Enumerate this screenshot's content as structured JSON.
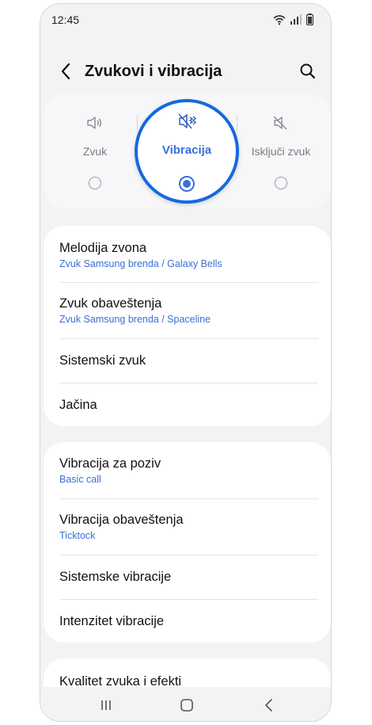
{
  "status_bar": {
    "time": "12:45"
  },
  "header": {
    "title": "Zvukovi i vibracija"
  },
  "sound_modes": [
    {
      "label": "Zvuk",
      "selected": false
    },
    {
      "label": "Vibracija",
      "selected": true
    },
    {
      "label": "Isključi zvuk",
      "selected": false
    }
  ],
  "section1": [
    {
      "title": "Melodija zvona",
      "subtitle": "Zvuk Samsung brenda / Galaxy Bells"
    },
    {
      "title": "Zvuk obaveštenja",
      "subtitle": "Zvuk Samsung brenda / Spaceline"
    },
    {
      "title": "Sistemski zvuk"
    },
    {
      "title": "Jačina"
    }
  ],
  "section2": [
    {
      "title": "Vibracija za poziv",
      "subtitle": "Basic call"
    },
    {
      "title": "Vibracija obaveštenja",
      "subtitle": "Ticktock"
    },
    {
      "title": "Sistemske vibracije"
    },
    {
      "title": "Intenzitet vibracije"
    }
  ],
  "section3": [
    {
      "title": "Kvalitet zvuka i efekti"
    }
  ],
  "colors": {
    "accent": "#3a6fd8",
    "highlight_ring": "#1569e0",
    "background": "#f3f3f6"
  },
  "icons": [
    "wifi-icon",
    "signal-icon",
    "battery-icon",
    "back-arrow-icon",
    "search-icon",
    "speaker-icon",
    "vibrate-icon",
    "mute-icon",
    "recents-icon",
    "home-icon",
    "nav-back-icon"
  ]
}
